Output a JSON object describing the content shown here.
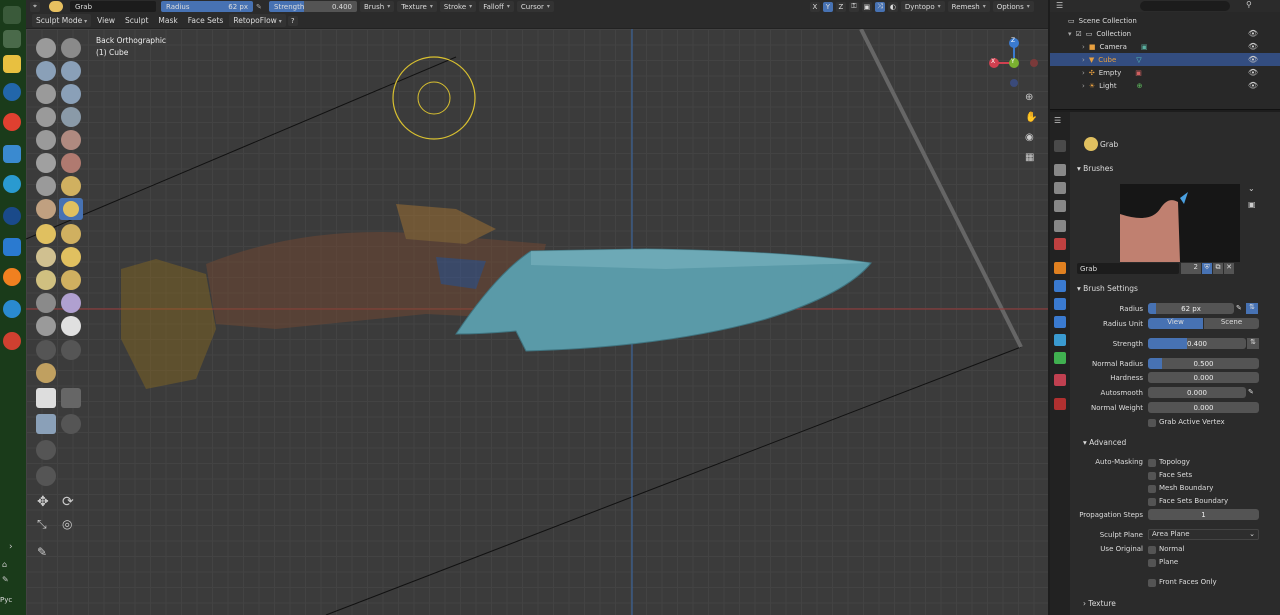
{
  "colors": {
    "accent": "#4772b3",
    "viewport": "#3b3b3b",
    "blade": "#5a9aa8",
    "panel": "#2b2b2b"
  },
  "topbar": {
    "brush_name": "Grab",
    "radius_label": "Radius",
    "radius_value": "62 px",
    "strength_label": "Strength",
    "strength_value": "0.400",
    "menus": [
      "Brush",
      "Texture",
      "Stroke",
      "Falloff",
      "Cursor"
    ],
    "axes": [
      "X",
      "Y",
      "Z"
    ],
    "dyntopo": "Dyntopo",
    "remesh": "Remesh",
    "options": "Options"
  },
  "menubar": {
    "mode": "Sculpt Mode",
    "items": [
      "View",
      "Sculpt",
      "Mask",
      "Face Sets"
    ],
    "addon": "RetopoFlow"
  },
  "viewport": {
    "view_name": "Back Orthographic",
    "object_name": "(1) Cube",
    "gizmo": {
      "x": "X",
      "y": "Y",
      "z": "Z"
    }
  },
  "outliner": {
    "root": "Scene Collection",
    "collection": "Collection",
    "items": [
      {
        "name": "Camera",
        "icon": "camera-icon"
      },
      {
        "name": "Cube",
        "icon": "mesh-icon",
        "selected": true
      },
      {
        "name": "Empty",
        "icon": "empty-icon"
      },
      {
        "name": "Light",
        "icon": "light-icon"
      }
    ]
  },
  "properties": {
    "tool_name": "Grab",
    "brushes_header": "Brushes",
    "brush_name": "Grab",
    "brush_users": "2",
    "brush_settings_header": "Brush Settings",
    "radius_label": "Radius",
    "radius_value": "62 px",
    "radius_unit_label": "Radius Unit",
    "radius_unit_view": "View",
    "radius_unit_scene": "Scene",
    "strength_label": "Strength",
    "strength_value": "0.400",
    "strength_fraction": 0.4,
    "normal_radius_label": "Normal Radius",
    "normal_radius_value": "0.500",
    "normal_radius_fraction": 0.5,
    "hardness_label": "Hardness",
    "hardness_value": "0.000",
    "autosmooth_label": "Autosmooth",
    "autosmooth_value": "0.000",
    "normal_weight_label": "Normal Weight",
    "normal_weight_value": "0.000",
    "grab_active_vertex": "Grab Active Vertex",
    "advanced_header": "Advanced",
    "auto_masking_label": "Auto-Masking",
    "auto_masking": [
      "Topology",
      "Face Sets",
      "Mesh Boundary",
      "Face Sets Boundary"
    ],
    "propagation_steps_label": "Propagation Steps",
    "propagation_steps_value": "1",
    "sculpt_plane_label": "Sculpt Plane",
    "sculpt_plane_value": "Area Plane",
    "use_original_label": "Use Original",
    "use_original": [
      "Normal",
      "Plane"
    ],
    "front_faces_only": "Front Faces Only",
    "texture_header": "Texture"
  },
  "taskbar": {
    "bottom_label": "Pyc"
  }
}
